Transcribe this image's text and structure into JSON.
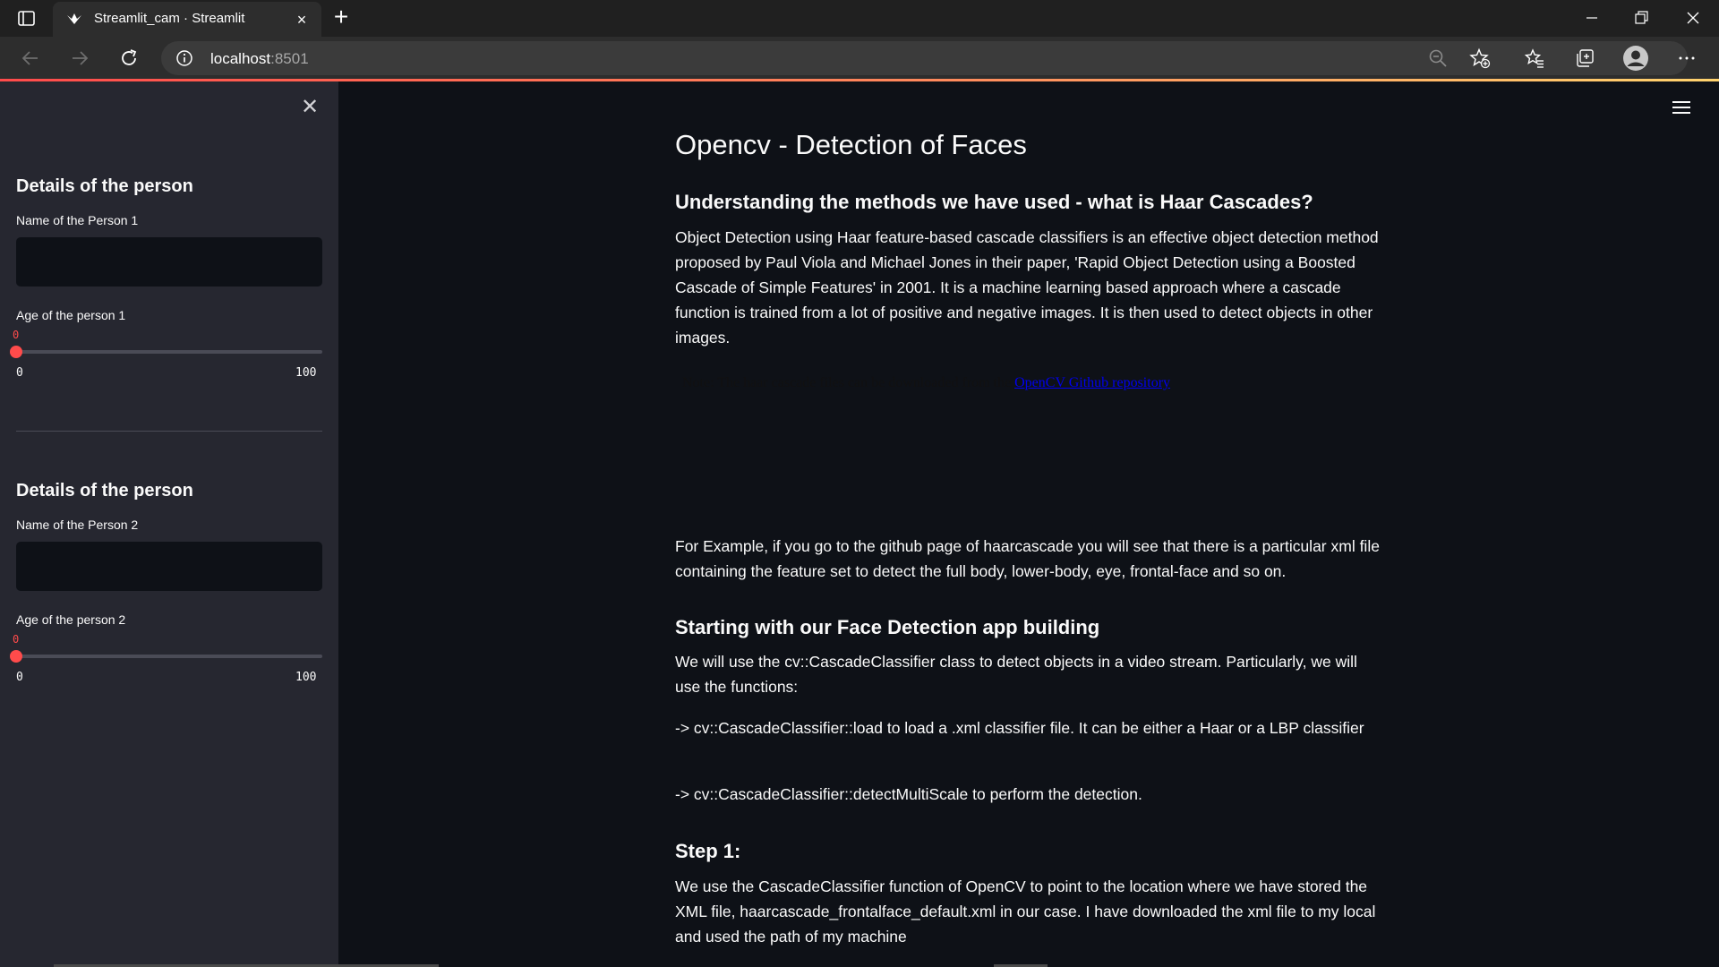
{
  "browser": {
    "tab_title": "Streamlit_cam · Streamlit",
    "new_tab_symbol": "+",
    "address_host": "localhost",
    "address_port": ":8501",
    "icons": [
      "tab-actions-icon",
      "back-icon",
      "forward-icon",
      "refresh-icon",
      "info-icon",
      "zoom-out-icon",
      "add-favorite-icon",
      "favorites-icon",
      "collections-icon",
      "profile-icon",
      "more-icon",
      "minimize-icon",
      "maximize-icon",
      "close-icon"
    ]
  },
  "sidebar": {
    "close_symbol": "✕",
    "person1": {
      "heading": "Details of the person",
      "name_label": "Name of the Person 1",
      "name_value": "",
      "age_label": "Age of the person 1",
      "age_value": "0",
      "age_min": "0",
      "age_max": "100",
      "age_fraction": 0
    },
    "person2": {
      "heading": "Details of the person",
      "name_label": "Name of the Person 2",
      "name_value": "",
      "age_label": "Age of the person 2",
      "age_value": "0",
      "age_min": "0",
      "age_max": "100",
      "age_fraction": 0
    }
  },
  "main": {
    "title": "Opencv - Detection of Faces",
    "section1_heading": "Understanding the methods we have used - what is Haar Cascades?",
    "section1_para": "Object Detection using Haar feature-based cascade classifiers is an effective object detection method proposed by Paul Viola and Michael Jones in their paper, 'Rapid Object Detection using a Boosted Cascade of Simple Features' in 2001. It is a machine learning based approach where a cascade function is trained from a lot of positive and negative images. It is then used to detect objects in other images.",
    "note_text": "Note: The haar cascade files can be downloaded from the ",
    "note_link": "OpenCV Github repository",
    "example_para": "For Example, if you go to the github page of haarcascade you will see that there is a particular xml file containing the feature set to detect the full body, lower-body, eye, frontal-face and so on.",
    "section2_heading": "Starting with our Face Detection app building",
    "section2_para": "We will use the cv::CascadeClassifier class to detect objects in a video stream. Particularly, we will use the functions:",
    "bullet1": "-> cv::CascadeClassifier::load to load a .xml classifier file. It can be either a Haar or a LBP classifier",
    "bullet2": "-> cv::CascadeClassifier::detectMultiScale to perform the detection.",
    "step1_heading": "Step 1:",
    "step1_para": "We use the CascadeClassifier function of OpenCV to point to the location where we have stored the XML file, haarcascade_frontalface_default.xml in our case. I have downloaded the xml file to my local and used the path of my machine",
    "colors": {
      "accent": "#ff4b4b",
      "sidebar_bg": "#262730",
      "main_bg": "#0e1117"
    }
  }
}
